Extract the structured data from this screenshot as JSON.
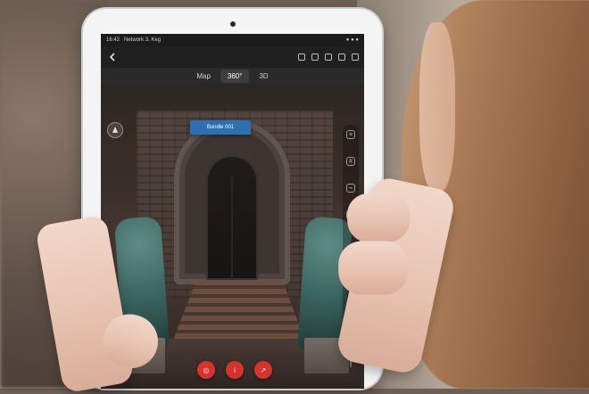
{
  "tabs": [
    {
      "label": "Map"
    },
    {
      "label": "360°"
    },
    {
      "label": "3D"
    }
  ],
  "overlay": {
    "bundle_label": "Bundle 001"
  },
  "status": {
    "time": "16:42",
    "app_name": "Network 3. Keg"
  },
  "colors": {
    "accent_blue": "#2d6fb3",
    "action_red": "#d6332d",
    "tablet_bezel": "#f4f4f4"
  },
  "icons": {
    "back": "chevron-left-icon",
    "compass": "compass-icon",
    "toolbar": [
      "layers-icon",
      "grid-icon",
      "filter-icon",
      "settings-icon"
    ],
    "bottom_actions": [
      "target-icon",
      "info-icon",
      "share-icon"
    ]
  },
  "slider": {
    "value_fraction": 0.78
  }
}
